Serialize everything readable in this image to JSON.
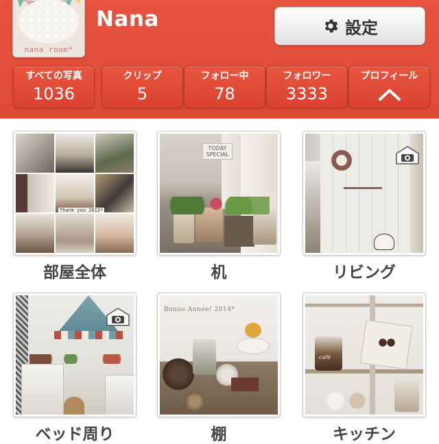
{
  "header": {
    "username": "Nana",
    "avatar_text": "nana room*",
    "settings_label": "設定",
    "settings_icon": "gear-icon",
    "brand_color": "#e2503b"
  },
  "stats": [
    {
      "label": "すべての写真",
      "value": "1036"
    },
    {
      "label": "クリップ",
      "value": "5"
    },
    {
      "label": "フォロー中",
      "value": "78"
    },
    {
      "label": "フォロワー",
      "value": "3333"
    },
    {
      "label": "プロフィール",
      "icon": "chevron-up-icon"
    }
  ],
  "photos": [
    {
      "caption": "部屋全体",
      "overlay_text": "Thank you 2013*"
    },
    {
      "caption": "机",
      "overlay_text": "TODAY SPECIAL"
    },
    {
      "caption": "リビング",
      "badge_icon": "camera-home-icon"
    },
    {
      "caption": "ベッド周り",
      "badge_icon": "camera-home-icon"
    },
    {
      "caption": "棚",
      "overlay_text": "Bonne Année! 2014*"
    },
    {
      "caption": "キッチン",
      "overlay_text": "café"
    }
  ]
}
